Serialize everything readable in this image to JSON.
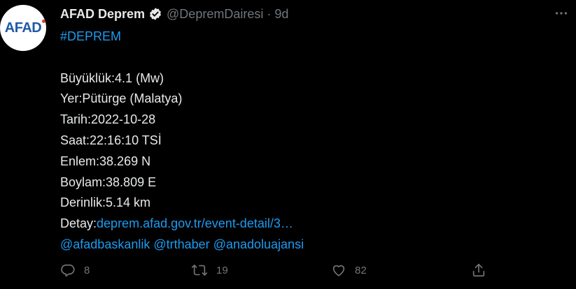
{
  "account": {
    "avatar_text": "AFAD",
    "display_name": "AFAD Deprem",
    "handle": "@DepremDairesi",
    "separator": "·",
    "timestamp": "9d"
  },
  "tweet": {
    "hashtag": "#DEPREM",
    "lines": [
      {
        "label": "Büyüklük:",
        "value": "4.1 (Mw)"
      },
      {
        "label": "Yer:",
        "value": "Pütürge (Malatya)"
      },
      {
        "label": "Tarih:",
        "value": "2022-10-28"
      },
      {
        "label": "Saat:",
        "value": "22:16:10 TSİ"
      },
      {
        "label": "Enlem:",
        "value": "38.269 N"
      },
      {
        "label": "Boylam:",
        "value": "38.809 E"
      },
      {
        "label": "Derinlik:",
        "value": "5.14 km"
      }
    ],
    "detail_label": "Detay:",
    "detail_link": "deprem.afad.gov.tr/event-detail/3…",
    "mentions": [
      "@afadbaskanlik",
      "@trthaber",
      "@anadoluajansi"
    ]
  },
  "actions": {
    "reply_count": "8",
    "retweet_count": "19",
    "like_count": "82"
  },
  "colors": {
    "background": "#000000",
    "text": "#e7e9ea",
    "secondary": "#71767b",
    "link": "#1d9bf0"
  }
}
